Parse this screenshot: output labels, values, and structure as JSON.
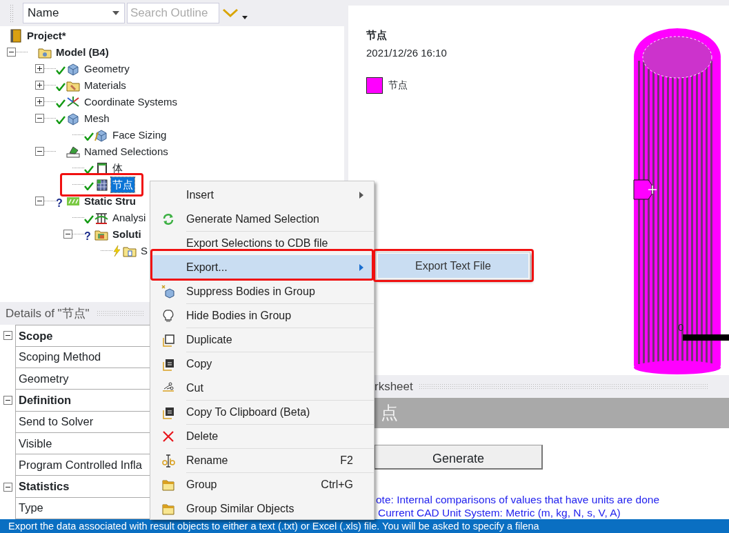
{
  "toolbar": {
    "sort_field": {
      "value": "Name"
    },
    "search": {
      "placeholder": "Search Outline"
    }
  },
  "outline": [
    {
      "label": "Project*",
      "bold": true,
      "selected": false,
      "children": [
        {
          "label": "Model (B4)",
          "bold": true,
          "expanded": true,
          "selected": false,
          "children": [
            {
              "label": "Geometry",
              "expanded": false,
              "kind": "done",
              "selected": false
            },
            {
              "label": "Materials",
              "expanded": false,
              "kind": "done",
              "selected": false
            },
            {
              "label": "Coordinate Systems",
              "expanded": false,
              "kind": "done",
              "selected": false
            },
            {
              "label": "Mesh",
              "expanded": true,
              "kind": "done",
              "selected": false,
              "children": [
                {
                  "label": "Face Sizing",
                  "kind": "done",
                  "selected": false
                }
              ]
            },
            {
              "label": "Named Selections",
              "expanded": true,
              "selected": false,
              "children": [
                {
                  "label": "体",
                  "kind": "done",
                  "selected": false
                },
                {
                  "label": "节点",
                  "kind": "done",
                  "selected": true
                }
              ]
            },
            {
              "label": "Static Stru",
              "bold": true,
              "expanded": true,
              "mark": "?",
              "selected": false,
              "children": [
                {
                  "label": "Analysi",
                  "kind": "done",
                  "selected": false
                },
                {
                  "label": "Soluti",
                  "bold": true,
                  "expanded": true,
                  "mark": "?",
                  "selected": false,
                  "children": [
                    {
                      "label": "S",
                      "kind": "pending",
                      "selected": false
                    }
                  ]
                }
              ]
            }
          ]
        }
      ]
    }
  ],
  "details": {
    "title": "Details of \"节点\"",
    "rows": [
      {
        "kind": "category",
        "label": "Scope",
        "expanded": true
      },
      {
        "kind": "property",
        "label": "Scoping Method"
      },
      {
        "kind": "property",
        "label": "Geometry"
      },
      {
        "kind": "category",
        "label": "Definition",
        "expanded": true
      },
      {
        "kind": "property",
        "label": "Send to Solver"
      },
      {
        "kind": "property",
        "label": "Visible"
      },
      {
        "kind": "property",
        "label": "Program Controlled Infla"
      },
      {
        "kind": "category",
        "label": "Statistics",
        "expanded": true
      },
      {
        "kind": "property",
        "label": "Type"
      }
    ]
  },
  "viewport": {
    "title": "节点",
    "timestamp": "2021/12/26 16:10",
    "legend": [
      {
        "label": "节点",
        "color": "#ff00ff"
      }
    ],
    "scale_label": "0"
  },
  "worksheet": {
    "header": "rksheet",
    "title": "点",
    "button": "Generate",
    "note": "ote: Internal comparisons of values that have units are done",
    "unit_line": "Current CAD Unit System:  Metric (m, kg, N, s, V, A)"
  },
  "context_menu": {
    "items": [
      {
        "label": "Insert",
        "submenu": true,
        "selected": false
      },
      {
        "label": "Generate Named Selection",
        "selected": false
      },
      {
        "label": "Export Selections to CDB file",
        "divider_above": true,
        "selected": false
      },
      {
        "label": "Export...",
        "submenu": true,
        "selected": true
      },
      {
        "label": "Suppress Bodies in Group",
        "selected": false
      },
      {
        "label": "Hide Bodies in Group",
        "divider_above": true,
        "selected": false
      },
      {
        "label": "Duplicate",
        "divider_above": true,
        "selected": false
      },
      {
        "label": "Copy",
        "divider_above": true,
        "selected": false
      },
      {
        "label": "Cut",
        "selected": false
      },
      {
        "label": "Copy To Clipboard (Beta)",
        "divider_above": true,
        "selected": false
      },
      {
        "label": "Delete",
        "divider_above": true,
        "selected": false
      },
      {
        "label": "Rename",
        "shortcut": "F2",
        "divider_above": true,
        "selected": false
      },
      {
        "label": "Group",
        "shortcut": "Ctrl+G",
        "divider_above": true,
        "selected": false
      },
      {
        "label": "Group Similar Objects",
        "selected": false
      }
    ]
  },
  "submenu": {
    "items": [
      {
        "label": "Export Text File",
        "selected": true
      }
    ]
  },
  "status_bar": "Export the data associated with result objects to either a text (.txt) or Excel (.xls) file. You will be asked to specify a filena"
}
